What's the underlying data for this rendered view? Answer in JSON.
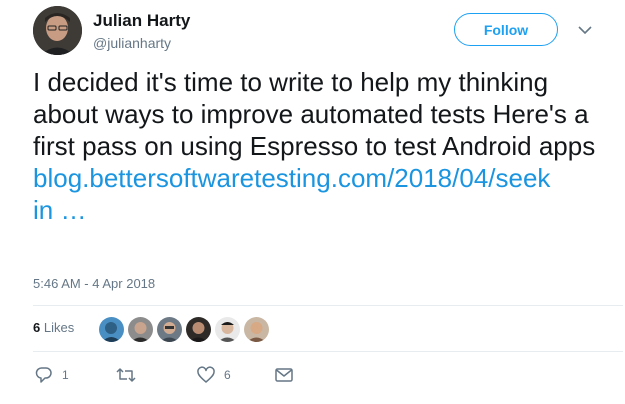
{
  "author": {
    "name": "Julian Harty",
    "handle": "@julianharty"
  },
  "follow_label": "Follow",
  "tweet": {
    "text": "I decided it's time to write to help my thinking about ways to improve automated tests Here's a first pass on using Espresso to test Android apps",
    "link_line1": "blog.bettersoftwaretesting.com/2018/04/seek",
    "link_line2": "in  …"
  },
  "timestamp": "5:46 AM - 4 Apr 2018",
  "likes": {
    "count": "6",
    "label": "Likes"
  },
  "actions": {
    "reply_count": "1",
    "retweet_count": "",
    "like_count": "6"
  },
  "icons": [
    "chevron-down-icon",
    "reply-icon",
    "retweet-icon",
    "heart-icon",
    "mail-icon"
  ],
  "colors": {
    "accent": "#1da1f2",
    "link": "#1b95e0",
    "muted": "#657786"
  }
}
